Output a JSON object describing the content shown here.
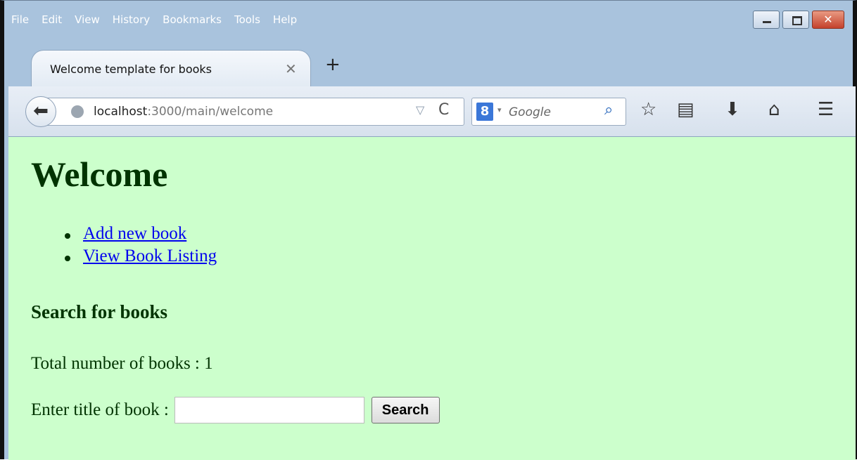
{
  "menu": [
    "File",
    "Edit",
    "View",
    "History",
    "Bookmarks",
    "Tools",
    "Help"
  ],
  "window_controls": {
    "close_label": "✕"
  },
  "tab": {
    "title": "Welcome template for books",
    "close": "✕",
    "new_tab": "+"
  },
  "nav": {
    "back": "⬅",
    "url_host": "localhost",
    "url_rest": ":3000/main/welcome",
    "dropdown": "▽",
    "reload": "C",
    "search_engine_glyph": "8",
    "search_engine_drop": "▾",
    "search_placeholder": "Google",
    "search_icon": "⌕",
    "bookmark_star": "☆",
    "reading_list": "▤",
    "downloads": "⬇",
    "home": "⌂",
    "menu": "☰"
  },
  "page": {
    "heading": "Welcome",
    "links": [
      "Add new book",
      "View Book Listing"
    ],
    "search_heading": "Search for books",
    "total_text": "Total number of books : 1",
    "enter_label": "Enter title of book :",
    "search_button": "Search",
    "title_input_value": ""
  },
  "colors": {
    "page_bg": "#ccffcc",
    "text": "#003300",
    "link": "#0000ee"
  }
}
